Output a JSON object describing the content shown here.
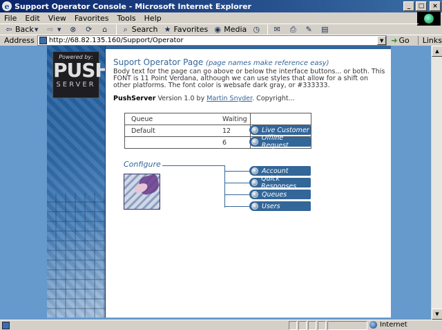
{
  "window": {
    "title": "Support Operator Console - Microsoft Internet Explorer",
    "minimize": "_",
    "maximize": "□",
    "close": "×"
  },
  "menu": [
    "File",
    "Edit",
    "View",
    "Favorites",
    "Tools",
    "Help"
  ],
  "toolbar": {
    "back": "Back",
    "search": "Search",
    "favorites": "Favorites",
    "media": "Media"
  },
  "address": {
    "label": "Address",
    "url": "http://68.82.135.160/Support/Operator",
    "go": "Go",
    "links": "Links"
  },
  "logo": {
    "powered_by": "Powered by:",
    "push": "PUSH",
    "server": "SERVER"
  },
  "page": {
    "title": "Suport Operator Page",
    "title_note": "(page names make reference easy)",
    "body": "Body text for the page can go above or below the interface buttons... or both.   This FONT is 11 Point Verdana, although we can use styles that allow for a shift on other platforms.  The font color is websafe dark gray, or #333333.",
    "product": "PushServer",
    "version_text": " Version 1.0 by ",
    "author": "Martin Snyder",
    "copyright": ".  Copyright..."
  },
  "queue_table": {
    "headers": [
      "Queue",
      "Waiting"
    ],
    "rows": [
      {
        "queue": "Default",
        "waiting": "12",
        "action": "Live Customer"
      },
      {
        "queue": "",
        "waiting": "6",
        "action": "Offline Request"
      }
    ]
  },
  "configure": {
    "label": "Configure",
    "items": [
      "Account",
      "Quick Responses",
      "Queues",
      "Users"
    ]
  },
  "status": {
    "zone": "Internet"
  },
  "colors": {
    "accent": "#336699",
    "background": "#6699cc",
    "text": "#333333"
  }
}
